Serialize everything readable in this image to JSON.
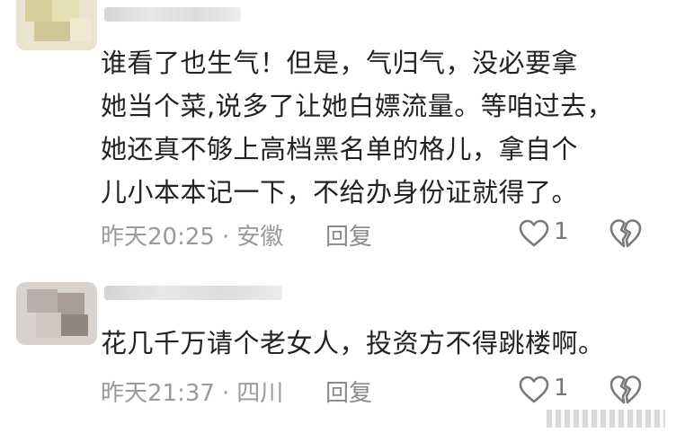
{
  "comments": [
    {
      "text_lines": [
        "谁看了也生气！但是，气归气，没必要拿",
        "她当个菜,说多了让她白嫖流量。等咱过去，",
        "她还真不够上高档黑名单的格儿，拿自个",
        "儿小本本记一下，不给办身份证就得了。"
      ],
      "time": "昨天20:25",
      "location": "安徽",
      "reply_label": "回复",
      "likes": "1",
      "like_icon": "heart-outline-icon",
      "dislike_icon": "broken-heart-icon"
    },
    {
      "text_lines": [
        "花几千万请个老女人，投资方不得跳楼啊。"
      ],
      "time": "昨天21:37",
      "location": "四川",
      "reply_label": "回复",
      "likes": "1",
      "like_icon": "heart-outline-icon",
      "dislike_icon": "broken-heart-icon"
    }
  ],
  "colors": {
    "text": "#222222",
    "meta": "#9a9a9a",
    "icon": "#7a7a7a"
  }
}
